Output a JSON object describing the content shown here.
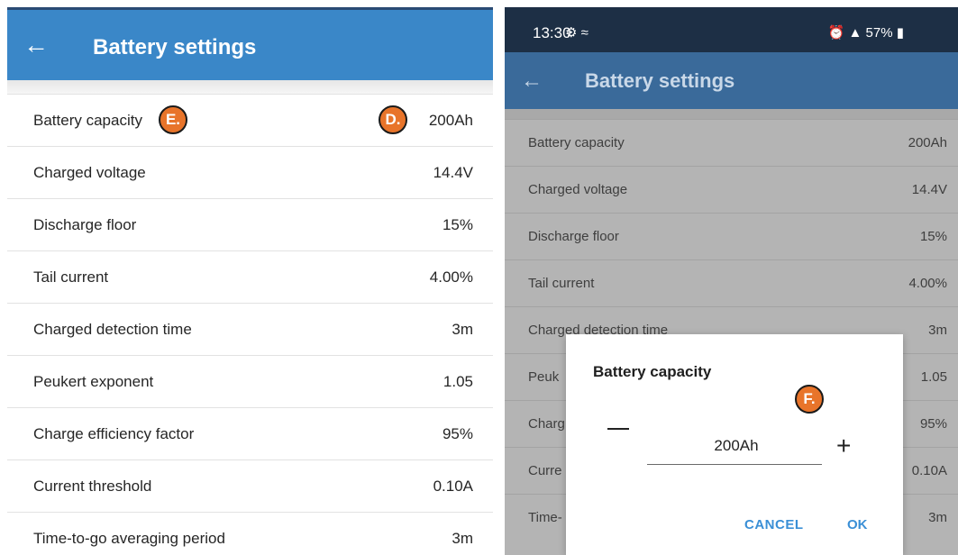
{
  "left": {
    "title": "Battery settings",
    "back_icon": "arrow-left-icon",
    "rows": [
      {
        "label": "Battery capacity",
        "value": "200Ah"
      },
      {
        "label": "Charged voltage",
        "value": "14.4V"
      },
      {
        "label": "Discharge floor",
        "value": "15%"
      },
      {
        "label": "Tail current",
        "value": "4.00%"
      },
      {
        "label": "Charged detection time",
        "value": "3m"
      },
      {
        "label": "Peukert exponent",
        "value": "1.05"
      },
      {
        "label": "Charge efficiency factor",
        "value": "95%"
      },
      {
        "label": "Current threshold",
        "value": "0.10A"
      },
      {
        "label": "Time-to-go averaging period",
        "value": "3m"
      }
    ],
    "markers": {
      "e": "E.",
      "d": "D."
    }
  },
  "right": {
    "status": {
      "time": "13:30",
      "battery": "57%"
    },
    "title": "Battery settings",
    "rows": [
      {
        "label": "Battery capacity",
        "value": "200Ah"
      },
      {
        "label": "Charged voltage",
        "value": "14.4V"
      },
      {
        "label": "Discharge floor",
        "value": "15%"
      },
      {
        "label": "Tail current",
        "value": "4.00%"
      },
      {
        "label": "Charged detection time",
        "value": "3m"
      },
      {
        "label": "Peuk",
        "value": "1.05"
      },
      {
        "label": "Charg",
        "value": "95%"
      },
      {
        "label": "Curre",
        "value": "0.10A"
      },
      {
        "label": "Time-",
        "value": "3m"
      }
    ],
    "dialog": {
      "title": "Battery capacity",
      "value": "200Ah",
      "cancel": "CANCEL",
      "ok": "OK",
      "marker": "F."
    }
  },
  "colors": {
    "appbar": "#3a87c8",
    "status_bar": "#1d2f45",
    "marker": "#e8742a",
    "dialog_button": "#3a8fd6"
  }
}
